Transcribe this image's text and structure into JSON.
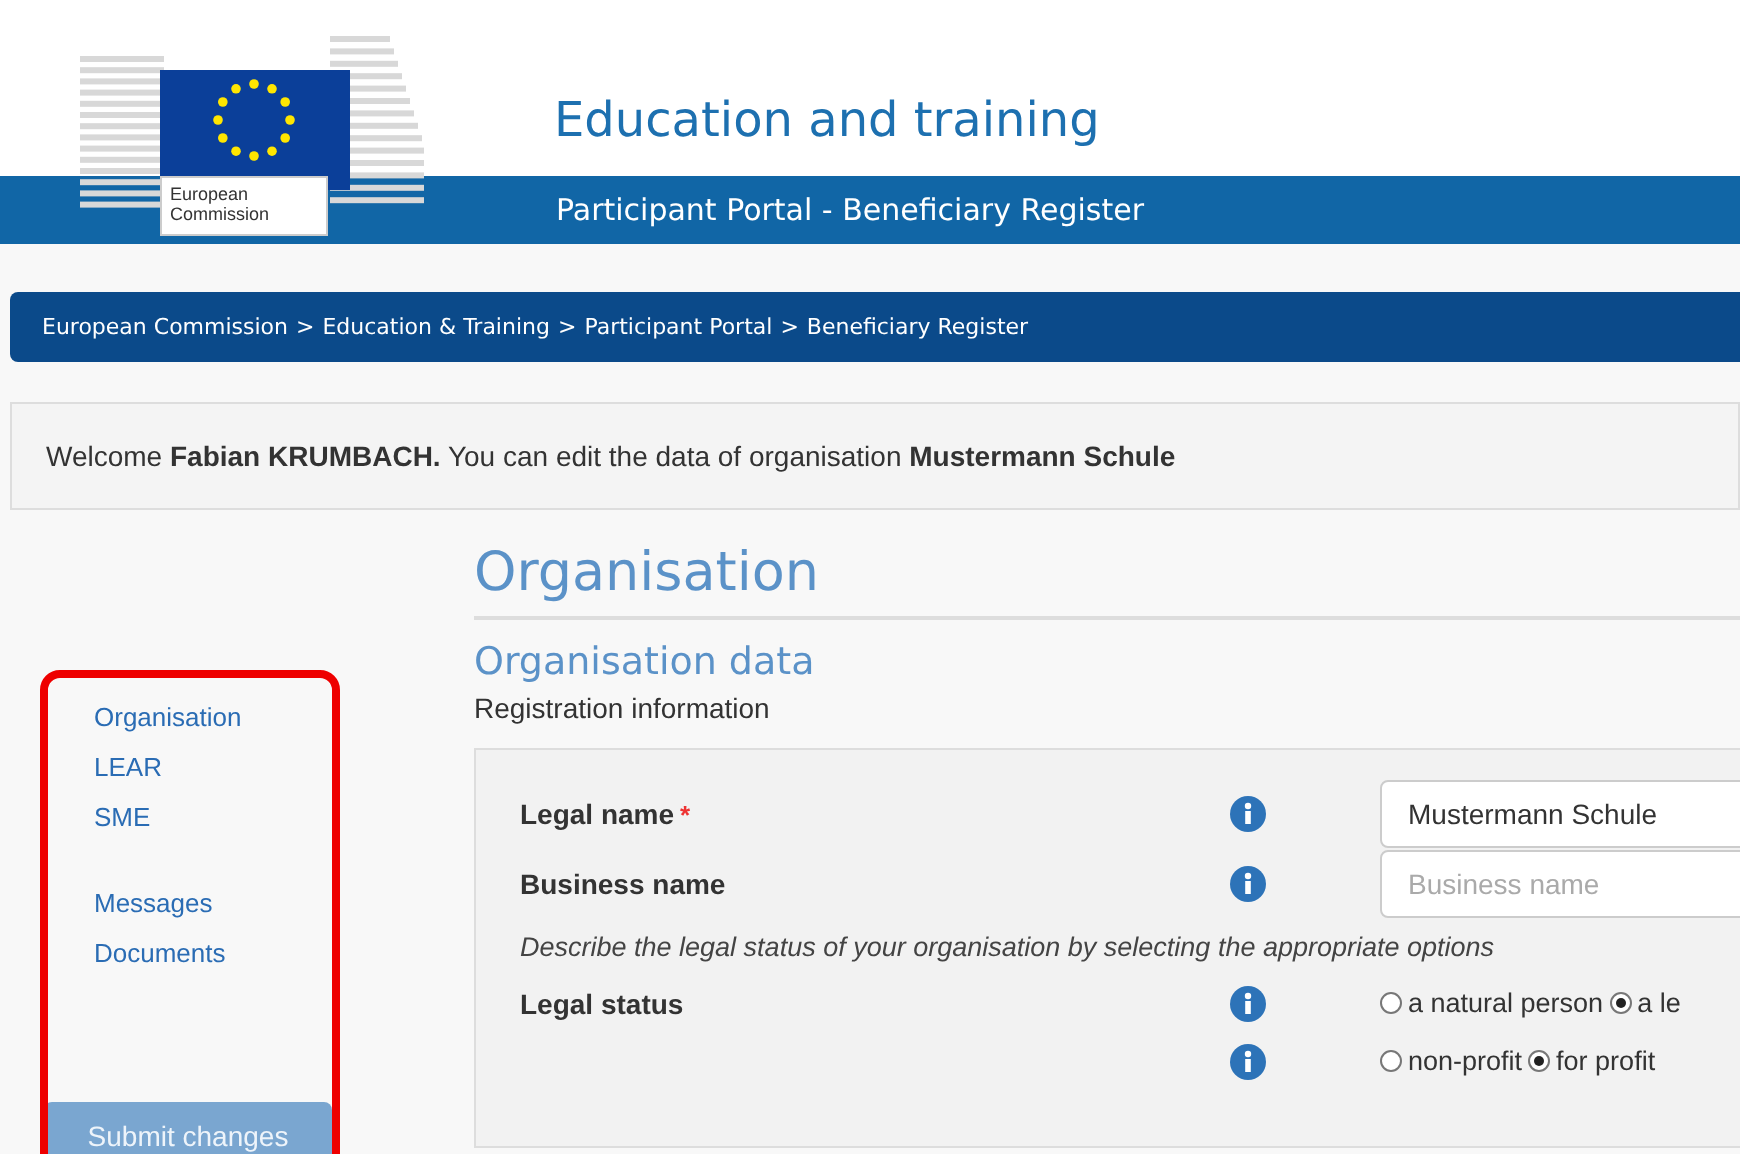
{
  "header": {
    "logo_text": "European Commission",
    "title": "Education and training",
    "subtitle": "Participant Portal - Beneficiary Register"
  },
  "breadcrumb": {
    "separator": ">",
    "items": [
      "European Commission",
      "Education & Training",
      "Participant Portal",
      "Beneficiary Register"
    ]
  },
  "welcome": "Welcome **Fabian KRUMBACH.** You can edit the data of organisation **Mustermann Schule**",
  "sidebar": {
    "groups": [
      [
        "Organisation",
        "LEAR",
        "SME"
      ],
      [
        "Messages",
        "Documents"
      ]
    ],
    "button": "Submit changes",
    "highlighted": true
  },
  "page_title": "Organisation",
  "section_title": "Organisation data",
  "subsection": "Registration information",
  "fields": [
    {
      "kind": "input",
      "label": "Legal name",
      "required_mark": "*",
      "value": "Mustermann Schule"
    },
    {
      "kind": "input",
      "label": "Business name",
      "placeholder": "Business name"
    },
    {
      "kind": "note",
      "text": "Describe the legal status of your organisation by selecting the appropriate options"
    },
    {
      "kind": "radio",
      "label": "Legal status",
      "options": [
        {
          "label": "a natural person",
          "selected": false
        },
        {
          "label": "a le",
          "selected": true
        }
      ]
    },
    {
      "kind": "radio",
      "options": [
        {
          "label": "non-profit",
          "selected": false
        },
        {
          "label": "for profit",
          "selected": true
        }
      ]
    }
  ]
}
